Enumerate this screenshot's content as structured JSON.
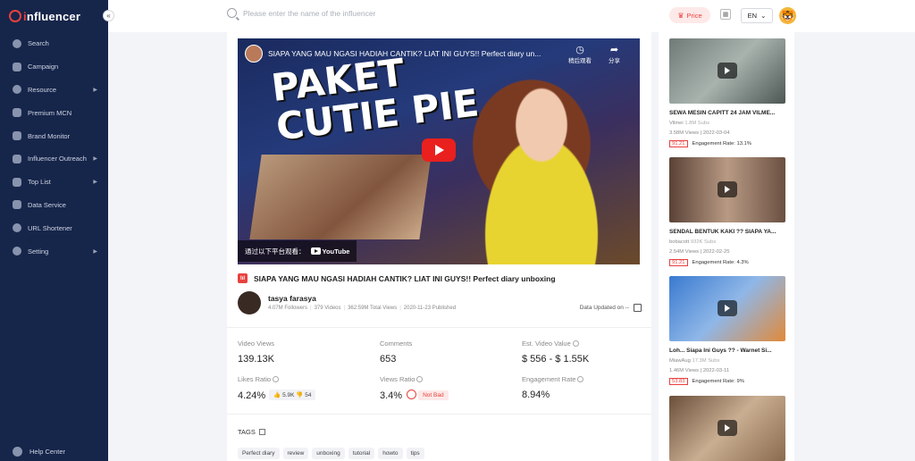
{
  "brand": {
    "logo_prefix": "i",
    "logo_text": "nfluencer"
  },
  "sidebar": {
    "items": [
      {
        "label": "Search",
        "has_arrow": false
      },
      {
        "label": "Campaign",
        "has_arrow": false
      },
      {
        "label": "Resource",
        "has_arrow": true
      },
      {
        "label": "Premium MCN",
        "has_arrow": false
      },
      {
        "label": "Brand Monitor",
        "has_arrow": false
      },
      {
        "label": "Influencer Outreach",
        "has_arrow": true
      },
      {
        "label": "Top List",
        "has_arrow": true
      },
      {
        "label": "Data Service",
        "has_arrow": false
      },
      {
        "label": "URL Shortener",
        "has_arrow": false
      },
      {
        "label": "Setting",
        "has_arrow": true
      }
    ],
    "help": "Help Center",
    "collapse_glyph": "«"
  },
  "topbar": {
    "search_placeholder": "Please enter the name of the influencer",
    "price_label": "Price",
    "lang": "EN"
  },
  "video": {
    "embed_title": "SIAPA YANG MAU NGASI HADIAH CANTIK? LIAT INI GUYS!! Perfect diary un...",
    "watch_later": "稍后观看",
    "share": "分享",
    "overlay_text": "PAKET CUTIE PIE",
    "watch_on": "通过以下平台观看：",
    "yt_label": "YouTube",
    "title": "SIAPA YANG MAU NGASI HADIAH CANTIK? LIAT INI GUYS!! Perfect diary unboxing"
  },
  "creator": {
    "name": "tasya farasya",
    "followers": "4.07M Followers",
    "videos": "379 Videos",
    "total_views": "362.59M Total Views",
    "published": "2020-11-23 Published",
    "data_updated": "Data Updated on --"
  },
  "stats": {
    "video_views_label": "Video Views",
    "video_views": "139.13K",
    "comments_label": "Comments",
    "comments": "653",
    "est_value_label": "Est. Video Value",
    "est_value": "$ 556 - $ 1.55K",
    "likes_ratio_label": "Likes Ratio",
    "likes_ratio": "4.24%",
    "likes": "5.9K",
    "dislikes": "54",
    "views_ratio_label": "Views Ratio",
    "views_ratio": "3.4%",
    "views_ratio_badge": "Not Bad",
    "engagement_label": "Engagement Rate",
    "engagement": "8.94%"
  },
  "tags": {
    "heading": "TAGS",
    "items": [
      "Perfect diary",
      "review",
      "unboxing",
      "tutorial",
      "howto",
      "tips"
    ]
  },
  "related": [
    {
      "title": "SEWA MESIN CAPITT 24 JAM VILME...",
      "channel": "Vilmei",
      "subs": "1.8M Subs",
      "views": "3.58M Views",
      "date": "2022-03-04",
      "score": "91.21",
      "er": "Engagement Rate: 13.1%",
      "thumb": "#7f8a86"
    },
    {
      "title": "SENDAL BENTUK KAKI ?? SIAPA YA...",
      "channel": "bobacott",
      "subs": "932K Subs",
      "views": "2.54M Views",
      "date": "2022-02-25",
      "score": "91.21",
      "er": "Engagement Rate: 4.3%",
      "thumb": "#8a6d5c"
    },
    {
      "title": "Loh... Siapa Ini Guys ?? - Warnet Si...",
      "channel": "MiawAug",
      "subs": "17.3M Subs",
      "views": "1.46M Views",
      "date": "2022-03-11",
      "score": "53.83",
      "er": "Engagement Rate: 9%",
      "thumb": "#4a7fc0"
    },
    {
      "title": "",
      "channel": "",
      "subs": "",
      "views": "",
      "date": "",
      "score": "",
      "er": "",
      "thumb": "#9a7a5c"
    }
  ],
  "colors": {
    "accent": "#e8413e",
    "sidebar": "#16254a"
  }
}
